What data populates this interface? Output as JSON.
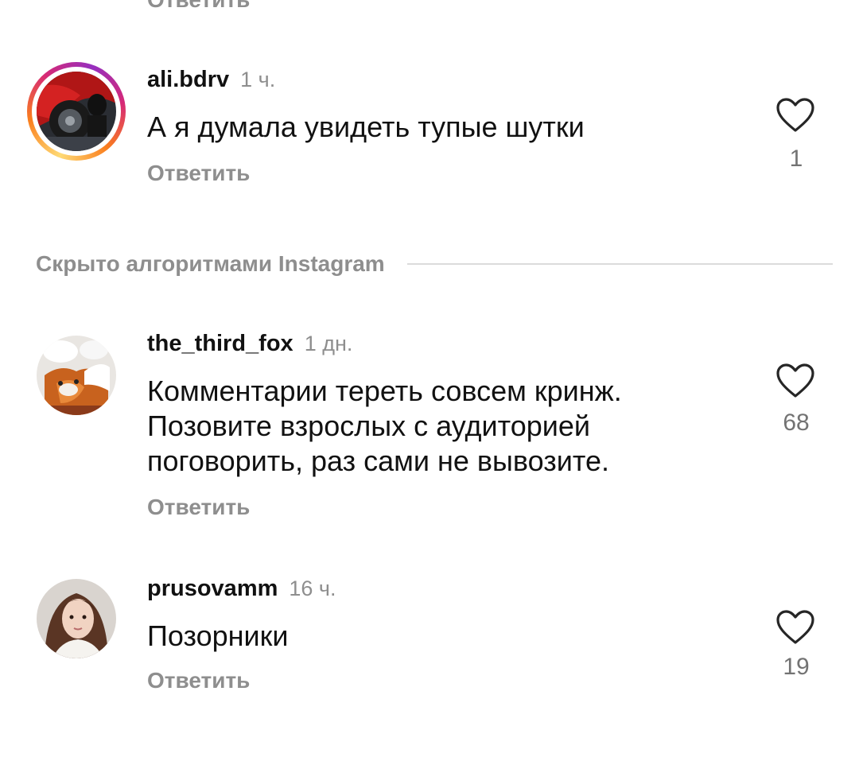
{
  "top_cut": {
    "reply_label": "Ответить"
  },
  "hidden_section": {
    "label": "Скрыто алгоритмами Instagram"
  },
  "comments": [
    {
      "username": "ali.bdrv",
      "time": "1 ч.",
      "text": "А я думала увидеть тупые шутки",
      "reply_label": "Ответить",
      "likes": "1",
      "has_story": true
    },
    {
      "username": "the_third_fox",
      "time": "1 дн.",
      "text": "Комментарии тереть совсем кринж. Позовите взрослых с аудиторией поговорить, раз сами не вывозите.",
      "reply_label": "Ответить",
      "likes": "68",
      "has_story": false
    },
    {
      "username": "prusovamm",
      "time": "16 ч.",
      "text": "Позорники",
      "reply_label": "Ответить",
      "likes": "19",
      "has_story": false
    }
  ],
  "colors": {
    "secondary_text": "#8e8e8e",
    "divider": "#dbdbdb",
    "like_icon": "#262626"
  },
  "icons": {
    "like": "heart-outline-icon"
  }
}
